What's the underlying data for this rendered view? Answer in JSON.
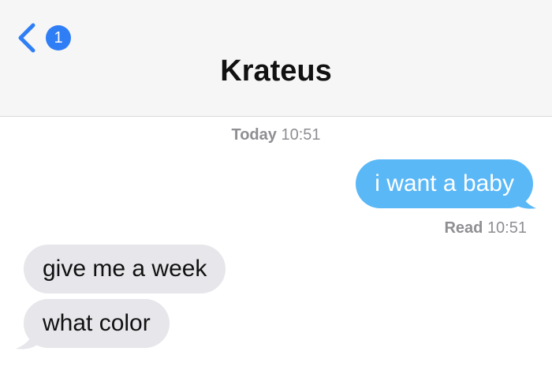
{
  "header": {
    "back_badge_count": "1",
    "contact_name": "Krateus"
  },
  "thread": {
    "timestamp_day": "Today",
    "timestamp_time": "10:51",
    "read_label": "Read",
    "read_time": "10:51",
    "messages": [
      {
        "direction": "sent",
        "text": "i want a baby"
      },
      {
        "direction": "received",
        "text": "give me a week"
      },
      {
        "direction": "received",
        "text": "what color"
      }
    ]
  },
  "colors": {
    "sent_bubble": "#5ab8f7",
    "received_bubble": "#e6e6eb",
    "badge": "#2f7ef6",
    "accent": "#2f7ef6"
  },
  "icons": {
    "back": "chevron-left-icon"
  }
}
